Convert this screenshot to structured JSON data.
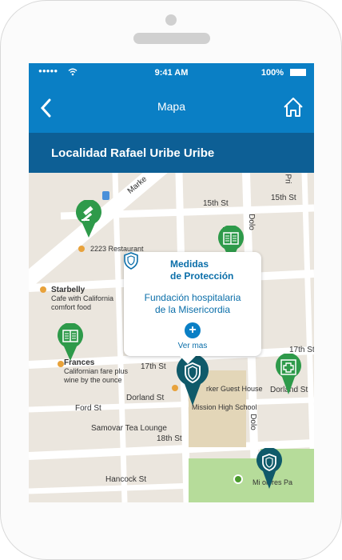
{
  "status_bar": {
    "signal": "●●●●●",
    "time": "9:41 AM",
    "battery": "100%"
  },
  "nav": {
    "title": "Mapa"
  },
  "subheader": {
    "title": "Localidad Rafael Uribe Uribe"
  },
  "map": {
    "streets": [
      "Marke",
      "15th St",
      "15th St",
      "Dolo",
      "Lan",
      "Pri",
      "17th St",
      "17th St",
      "Dorland St",
      "Dorland St",
      "Ford St",
      "Samovar Tea Lounge",
      "18th St",
      "Hancock St",
      "Dolo"
    ],
    "pois": {
      "restaurant": "2223 Restaurant",
      "starbelly_name": "Starbelly",
      "starbelly_desc1": "Cafe with California",
      "starbelly_desc2": "comfort food",
      "frances_name": "Frances",
      "frances_desc1": "Californian fare plus",
      "frances_desc2": "wine by the ounce",
      "guest_house": "rker Guest House",
      "school": "Mission High School",
      "park": "Mi     olores Pa"
    }
  },
  "popup": {
    "title_line1": "Medidas",
    "title_line2": "de Protección",
    "subtitle_line1": "Fundación hospitalaria",
    "subtitle_line2": "de la Misericordia",
    "add": "+",
    "link": "Ver mas"
  },
  "icons": {
    "court": "gavel-icon",
    "education": "book-icon",
    "protection": "shield-icon",
    "health": "medical-cross-icon"
  },
  "colors": {
    "primary": "#0a7fc5",
    "secondary": "#0d5f95",
    "pin_green": "#2e9a4a",
    "pin_teal": "#0f5a6a"
  }
}
